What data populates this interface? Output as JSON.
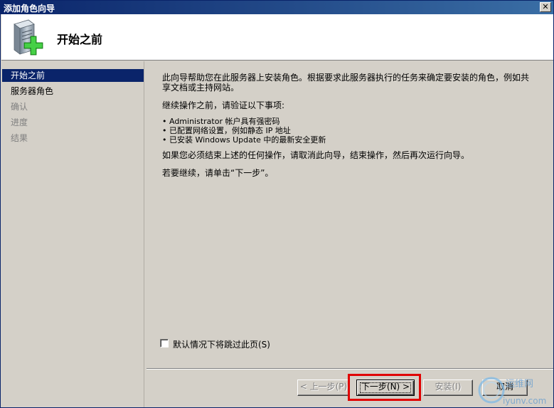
{
  "window": {
    "title": "添加角色向导",
    "close_glyph": "✕"
  },
  "header": {
    "title": "开始之前",
    "icon": "server-add-icon"
  },
  "nav": {
    "items": [
      {
        "label": "开始之前",
        "state": "active"
      },
      {
        "label": "服务器角色",
        "state": "normal"
      },
      {
        "label": "确认",
        "state": "disabled"
      },
      {
        "label": "进度",
        "state": "disabled"
      },
      {
        "label": "结果",
        "state": "disabled"
      }
    ]
  },
  "content": {
    "intro_line1": "此向导帮助您在此服务器上安装角色。根据要求此服务器执行的任务来确定要安装的角色，例如共",
    "intro_line2": "享文档或主持网站。",
    "verify_heading": "继续操作之前，请验证以下事项:",
    "bullets": [
      "• Administrator 帐户具有强密码",
      "• 已配置网络设置，例如静态 IP 地址",
      "• 已安装 Windows Update 中的最新安全更新"
    ],
    "cancel_hint": "如果您必须结束上述的任何操作，请取消此向导，结束操作，然后再次运行向导。",
    "continue_hint": "若要继续，请单击“下一步”。"
  },
  "skip_checkbox": {
    "label": "默认情况下将跳过此页(S)",
    "checked": false
  },
  "buttons": {
    "prev": "< 上一步(P)",
    "next": "下一步(N) >",
    "install": "安装(I)",
    "cancel": "取消"
  },
  "watermark": {
    "text_top": "运维网",
    "text_bottom": "iyunv.com"
  },
  "colors": {
    "title_bar": "#0a246a",
    "selection": "#0a246a",
    "highlight_box": "#e00000",
    "dialog_bg": "#d4d0c8"
  }
}
